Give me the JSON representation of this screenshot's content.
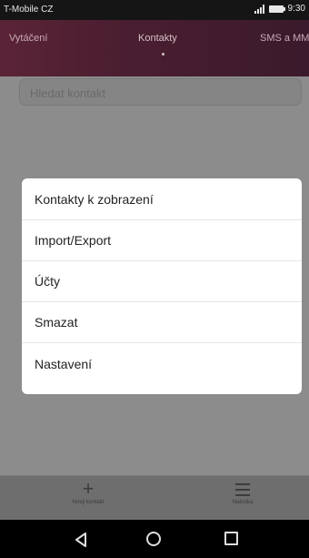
{
  "status_bar": {
    "carrier": "T-Mobile CZ",
    "time": "9:30",
    "icons": [
      "signal-icon",
      "battery-icon"
    ]
  },
  "tabs": [
    {
      "label": "Vytáčení",
      "active": false
    },
    {
      "label": "Kontakty",
      "active": true
    },
    {
      "label": "SMS a MMS",
      "active": false
    }
  ],
  "search": {
    "placeholder": "Hledat kontakt"
  },
  "menu": {
    "items": [
      {
        "label": "Kontakty k zobrazení"
      },
      {
        "label": "Import/Export"
      },
      {
        "label": "Účty"
      },
      {
        "label": "Smazat"
      },
      {
        "label": "Nastavení"
      }
    ]
  },
  "toolbar": {
    "new_contact_label": "Nový kontakt",
    "menu_label": "Nabídka"
  },
  "colors": {
    "tab_bar": "#4a1e30",
    "overlay": "#8c8c8c",
    "menu_bg": "#ffffff"
  }
}
